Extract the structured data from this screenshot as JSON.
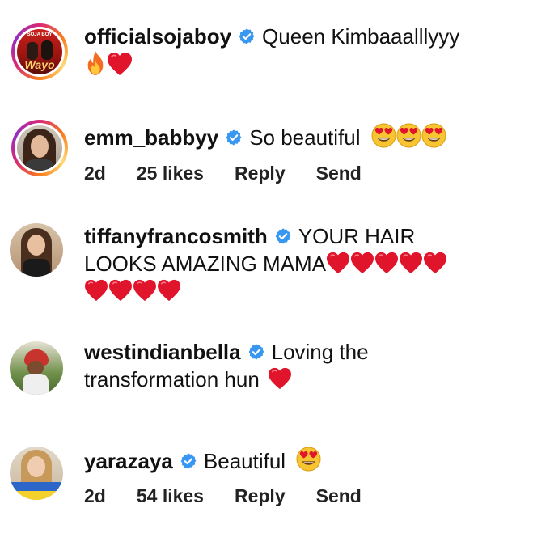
{
  "comments": [
    {
      "username": "officialsojaboy",
      "text": "Queen Kimbaaalllyyy",
      "emojis": [
        "fire-emoji",
        "heart-emoji"
      ],
      "avatar": {
        "label": "Wayo",
        "sublabel": "SOJA BOY",
        "ring": true
      }
    },
    {
      "username": "emm_babbyy",
      "text": "So beautiful",
      "emojis": [
        "heart-eyes-emoji",
        "heart-eyes-emoji",
        "heart-eyes-emoji"
      ],
      "meta": {
        "time": "2d",
        "likes": "25 likes",
        "reply": "Reply",
        "send": "Send"
      }
    },
    {
      "username": "tiffanyfrancosmith",
      "text_line1": "YOUR HAIR",
      "text_line2": "LOOKS AMAZING MAMA",
      "emojis": [
        "heart-emoji",
        "heart-emoji",
        "heart-emoji",
        "heart-emoji",
        "heart-emoji",
        "heart-emoji",
        "heart-emoji",
        "heart-emoji",
        "heart-emoji"
      ]
    },
    {
      "username": "westindianbella",
      "text_line1": "Loving the",
      "text_line2": "transformation hun",
      "emojis": [
        "heart-emoji"
      ]
    },
    {
      "username": "yarazaya",
      "text": "Beautiful",
      "emojis": [
        "heart-eyes-emoji"
      ],
      "meta": {
        "time": "2d",
        "likes": "54 likes",
        "reply": "Reply",
        "send": "Send"
      }
    }
  ],
  "colors": {
    "verified": "#3897f0",
    "heart": "#e0142b",
    "emoji_face": "#f7c531"
  }
}
